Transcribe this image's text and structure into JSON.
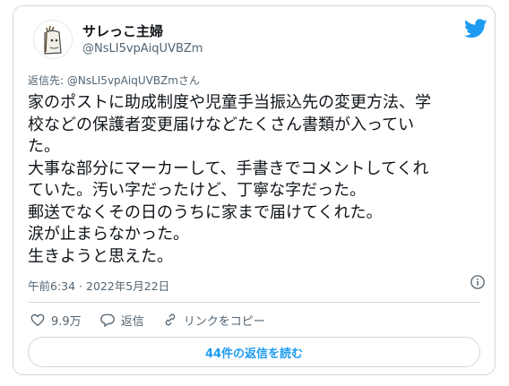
{
  "user": {
    "name": "サレっこ主婦",
    "handle": "@NsLI5vpAiqUVBZm"
  },
  "reply_to": "返信先: @NsLI5vpAiqUVBZmさん",
  "tweet": {
    "lines": [
      "家のポストに助成制度や児童手当振込先の変更方法、学",
      "校などの保護者変更届けなどたくさん書類が入ってい",
      "た。",
      "大事な部分にマーカーして、手書きでコメントしてくれ",
      "ていた。汚い字だったけど、丁寧な字だった。",
      "郵送でなくその日のうちに家まで届けてくれた。",
      "涙が止まらなかった。",
      "生きようと思えた。"
    ],
    "timestamp": "午前6:34 · 2022年5月22日"
  },
  "actions": {
    "like_count": "9.9万",
    "reply_label": "返信",
    "copy_link_label": "リンクをコピー"
  },
  "read_replies_label": "44件の返信を読む",
  "colors": {
    "accent": "#1d9bf0",
    "text": "#0f1419",
    "muted": "#536471",
    "border": "#cfd9de"
  }
}
